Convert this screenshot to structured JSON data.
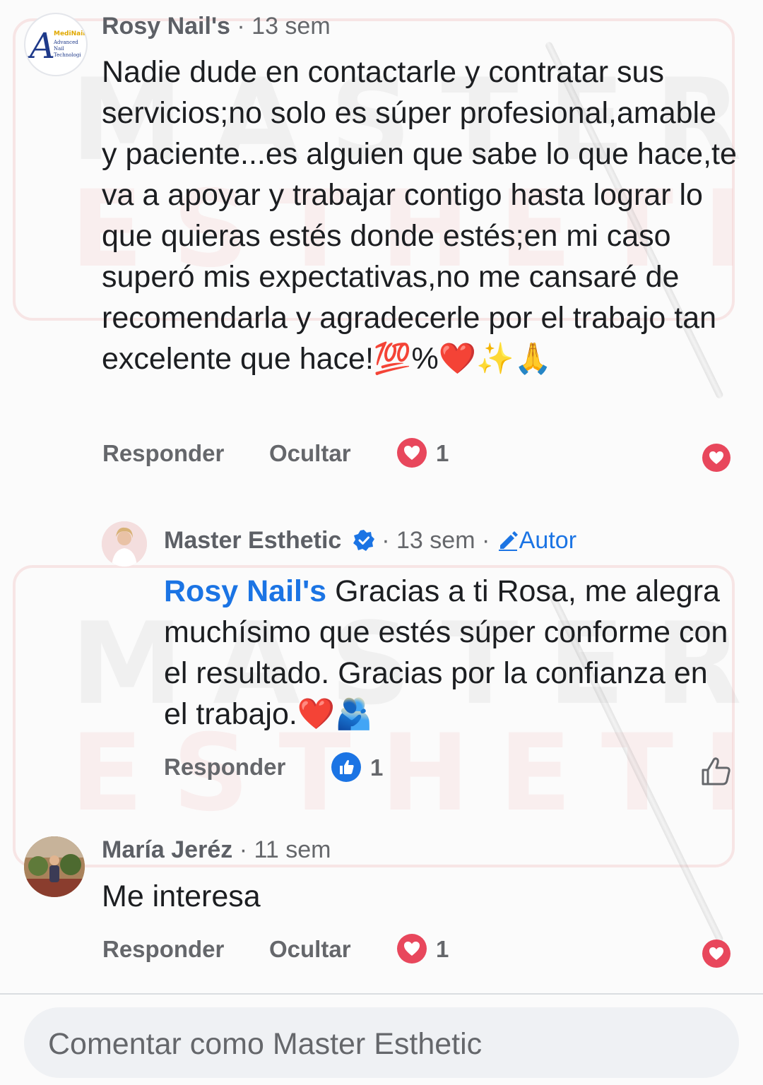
{
  "watermark": {
    "line1": "MASTER",
    "line2": "ESTHETIC"
  },
  "comments": [
    {
      "author": "Rosy Nail's",
      "time": "13 sem",
      "text": "Nadie dude en contactarle y contratar sus servicios;no solo es súper profesional,amable y paciente...es alguien que sabe lo que hace,te va a apoyar y trabajar contigo hasta lograr lo que quieras estés donde estés;en mi caso superó mis expectativas,no me cansaré de recomendarla y agradecerle por el trabajo tan excelente que hace!💯%❤️✨🙏",
      "reply_label": "Responder",
      "hide_label": "Ocultar",
      "reaction_count": "1",
      "reaction_icon": "heart-icon",
      "avatar_lines": [
        "MediNail",
        "Advanced",
        "Nail",
        "Technologi"
      ]
    },
    {
      "author": "Master Esthetic",
      "verified": true,
      "time": "13 sem",
      "author_badge": "Autor",
      "mention": "Rosy Nail's",
      "text": "Gracias a ti Rosa, me alegra muchísimo que estés súper conforme con el resultado. Gracias por la confianza en el trabajo.❤️🫂",
      "reply_label": "Responder",
      "reaction_count": "1",
      "reaction_icon": "like-icon"
    },
    {
      "author": "María Jeréz",
      "time": "11 sem",
      "text": "Me interesa",
      "reply_label": "Responder",
      "hide_label": "Ocultar",
      "reaction_count": "1",
      "reaction_icon": "heart-icon"
    }
  ],
  "composer": {
    "placeholder": "Comentar como Master Esthetic"
  },
  "colors": {
    "accent": "#1b74e4",
    "heart": "#e8475c",
    "secondary_text": "#65676b"
  }
}
